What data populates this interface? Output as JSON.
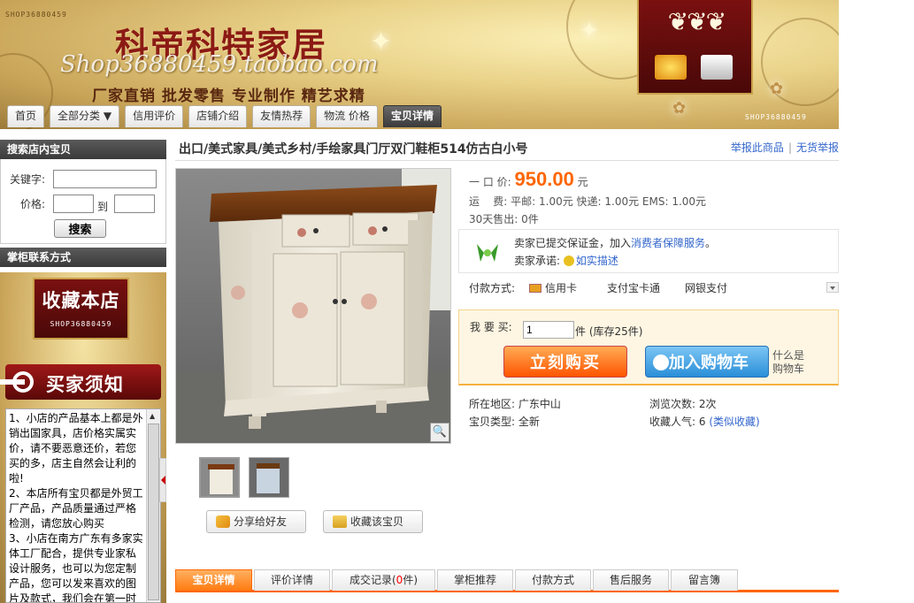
{
  "banner": {
    "watermark": "SHOP36880459",
    "shop_name": "科帝科特家居",
    "shop_url": "Shop36880459.taobao.com",
    "slogan": "厂家直销 批发零售 专业制作 精艺求精"
  },
  "nav": {
    "tabs": [
      {
        "label": "首页"
      },
      {
        "label": "全部分类 ▼"
      },
      {
        "label": "信用评价"
      },
      {
        "label": "店铺介绍"
      },
      {
        "label": "友情热荐"
      },
      {
        "label": "物流 价格"
      },
      {
        "label": "宝贝详情",
        "active": true
      }
    ]
  },
  "sidebar": {
    "search": {
      "header": "搜索店内宝贝",
      "keyword_label": "关键字:",
      "price_label": "价格:",
      "to_label": "到",
      "button": "搜索"
    },
    "contact": {
      "header": "掌柜联系方式",
      "collect_shop": "收藏本店",
      "collect_shop_sub": "SHOP36880459",
      "buyer_notice_title": "买家须知"
    },
    "notice_lines": [
      "1、小店的产品基本上都是外销出国家具，店价格实属实价，请不要恶意还价，若您买的多，店主自然会让利的啦!",
      "2、本店所有宝贝都是外贸工厂产品，产品质量通过严格检测，请您放心购买",
      "3、小店在南方广东有多家实体工厂配合，提供专业家私设计服务，也可以为您定制产品，您可以发来喜欢的图片及款式，我们会在第一时"
    ]
  },
  "product": {
    "title": "出口/美式家具/美式乡村/手绘家具门厅双门鞋柜514仿古白小号",
    "report_link": "举报此商品",
    "no_goods_report": "无货举报",
    "price_label": "一 口 价:",
    "price": "950.00",
    "price_unit": "元",
    "shipping_label": "运    费:",
    "shipping": "平邮: 1.00元 快递: 1.00元 EMS: 1.00元",
    "sold_label": "30天售出:",
    "sold": "0件",
    "guarantee_1_prefix": "卖家已提交保证金，加入",
    "guarantee_1_link": "消费者保障服务",
    "guarantee_1_suffix": "。",
    "guarantee_2_prefix": "卖家承诺:",
    "guarantee_2_link": "如实描述",
    "pay_label": "付款方式:",
    "pay_methods": [
      "信用卡",
      "支付宝卡通",
      "网银支付"
    ],
    "buy_label": "我 要 买:",
    "quantity": "1",
    "stock": "件  (库存25件)",
    "buy_now": "立刻购买",
    "add_to_cart": "加入购物车",
    "cart_help_1": "什么是",
    "cart_help_2": "购物车",
    "location_label": "所在地区:",
    "location": "广东中山",
    "views_label": "浏览次数:",
    "views": "2次",
    "type_label": "宝贝类型:",
    "type": "全新",
    "popularity_label": "收藏人气:",
    "popularity": "6",
    "similar_link": "(类似收藏)",
    "share_button": "分享给好友",
    "collect_button": "收藏该宝贝"
  },
  "detail_tabs": [
    {
      "label": "宝贝详情",
      "active": true
    },
    {
      "label": "评价详情"
    },
    {
      "label": "成交记录(",
      "count": "0",
      "suffix": "件)"
    },
    {
      "label": "掌柜推荐"
    },
    {
      "label": "付款方式"
    },
    {
      "label": "售后服务"
    },
    {
      "label": "留言簿"
    }
  ],
  "colors": {
    "price": "#ff6600",
    "link": "#3366cc",
    "accent_orange": "#ff6600",
    "sidebar_header": "#3a3a3a"
  }
}
